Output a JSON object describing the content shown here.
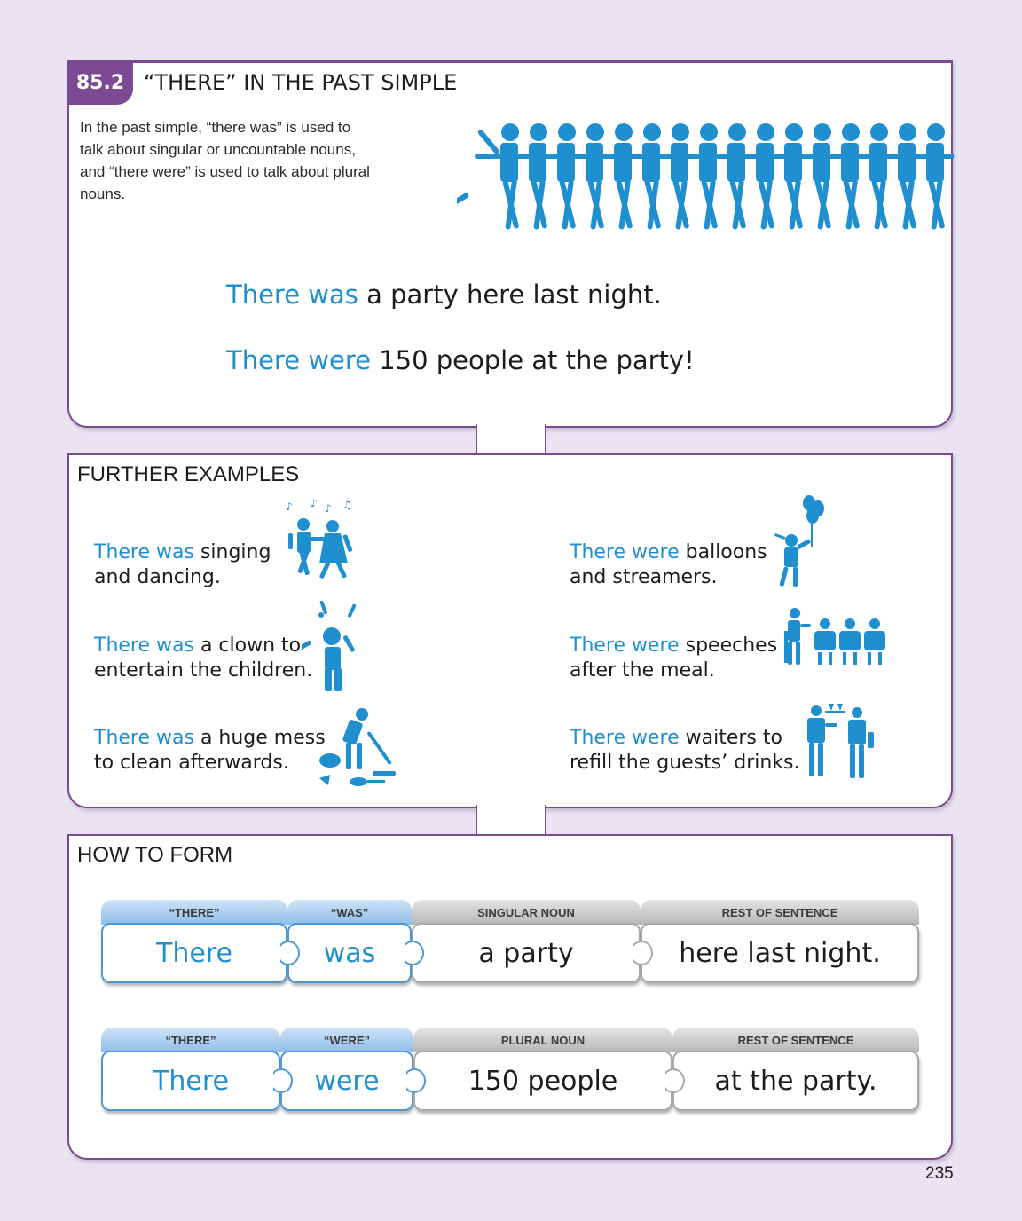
{
  "header": {
    "section_number": "85.2",
    "section_title": "“THERE” IN THE PAST SIMPLE"
  },
  "intro": "In the past simple, “there was” is used to talk about singular or uncountable nouns, and “there were” is used to talk about plural nouns.",
  "main_examples": [
    {
      "keyword": "There was",
      "rest": " a party here last night."
    },
    {
      "keyword": "There were",
      "rest": " 150 people at the party!"
    }
  ],
  "further_examples": {
    "title": "FURTHER EXAMPLES",
    "left": [
      {
        "keyword": "There was",
        "line1_rest": " singing",
        "line2": "and dancing."
      },
      {
        "keyword": "There was",
        "line1_rest": " a clown to",
        "line2": "entertain the children."
      },
      {
        "keyword": "There was",
        "line1_rest": " a huge mess",
        "line2": "to clean afterwards."
      }
    ],
    "right": [
      {
        "keyword": "There were",
        "line1_rest": " balloons",
        "line2": "and streamers."
      },
      {
        "keyword": "There were",
        "line1_rest": " speeches",
        "line2": "after the meal."
      },
      {
        "keyword": "There were",
        "line1_rest": " waiters to",
        "line2": "refill the guests’ drinks."
      }
    ]
  },
  "how_to_form": {
    "title": "HOW TO FORM",
    "rows": [
      {
        "labels": [
          "“THERE”",
          "“WAS”",
          "SINGULAR NOUN",
          "REST OF SENTENCE"
        ],
        "words": [
          "There",
          "was",
          "a party",
          "here last night."
        ]
      },
      {
        "labels": [
          "“THERE”",
          "“WERE”",
          "PLURAL NOUN",
          "REST OF SENTENCE"
        ],
        "words": [
          "There",
          "were",
          "150 people",
          "at the party."
        ]
      }
    ]
  },
  "page_number": "235",
  "colors": {
    "accent_blue": "#1f8fcf",
    "panel_border_purple": "#7b4a93",
    "page_background": "#e9e3f2"
  }
}
